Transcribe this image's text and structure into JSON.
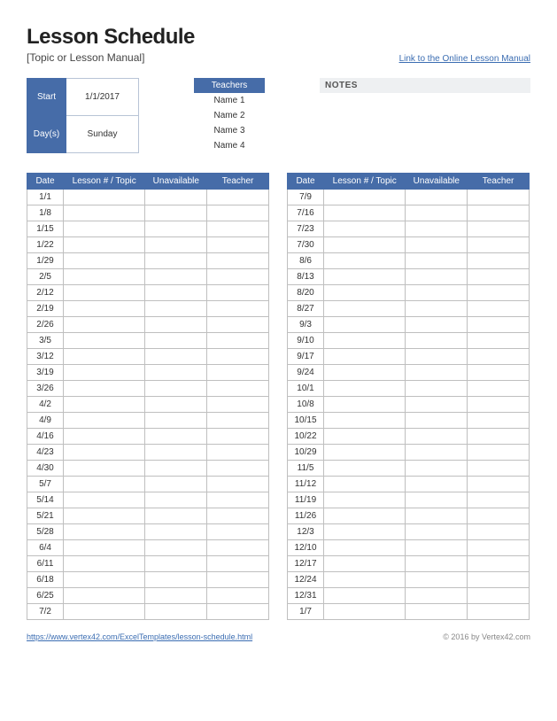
{
  "header": {
    "title": "Lesson Schedule",
    "subtitle": "[Topic or Lesson Manual]",
    "online_link": "Link to the Online Lesson Manual"
  },
  "meta": {
    "start_label": "Start",
    "start_value": "1/1/2017",
    "days_label": "Day(s)",
    "days_value": "Sunday",
    "teachers_label": "Teachers",
    "teachers": [
      "Name 1",
      "Name 2",
      "Name 3",
      "Name 4"
    ],
    "notes_label": "NOTES"
  },
  "columns": {
    "date": "Date",
    "topic": "Lesson # / Topic",
    "unavailable": "Unavailable",
    "teacher": "Teacher"
  },
  "left_dates": [
    "1/1",
    "1/8",
    "1/15",
    "1/22",
    "1/29",
    "2/5",
    "2/12",
    "2/19",
    "2/26",
    "3/5",
    "3/12",
    "3/19",
    "3/26",
    "4/2",
    "4/9",
    "4/16",
    "4/23",
    "4/30",
    "5/7",
    "5/14",
    "5/21",
    "5/28",
    "6/4",
    "6/11",
    "6/18",
    "6/25",
    "7/2"
  ],
  "right_dates": [
    "7/9",
    "7/16",
    "7/23",
    "7/30",
    "8/6",
    "8/13",
    "8/20",
    "8/27",
    "9/3",
    "9/10",
    "9/17",
    "9/24",
    "10/1",
    "10/8",
    "10/15",
    "10/22",
    "10/29",
    "11/5",
    "11/12",
    "11/19",
    "11/26",
    "12/3",
    "12/10",
    "12/17",
    "12/24",
    "12/31",
    "1/7"
  ],
  "footer": {
    "link": "https://www.vertex42.com/ExcelTemplates/lesson-schedule.html",
    "copyright": "© 2016 by Vertex42.com"
  }
}
